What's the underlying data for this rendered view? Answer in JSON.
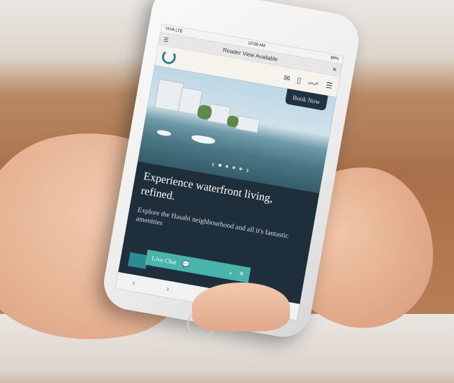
{
  "status_bar": {
    "carrier": "VIVA LTE",
    "time": "10:08 AM",
    "battery": "88%"
  },
  "reader_bar": {
    "label": "Reader View Available"
  },
  "site_header": {
    "lang_label": "عربي"
  },
  "hero": {
    "book_now_label": "Book Now",
    "carousel": {
      "dot_count": 4,
      "active_index": 0
    }
  },
  "content": {
    "headline": "Experience waterfront living, refined.",
    "subtext": "Explore the Hasabi neighbourhood and all it's fantastic amenities"
  },
  "live_chat": {
    "label": "Live Chat"
  },
  "colors": {
    "accent": "#49b4aa",
    "dark": "#1f3344",
    "header_bg": "#f6f3ec"
  }
}
